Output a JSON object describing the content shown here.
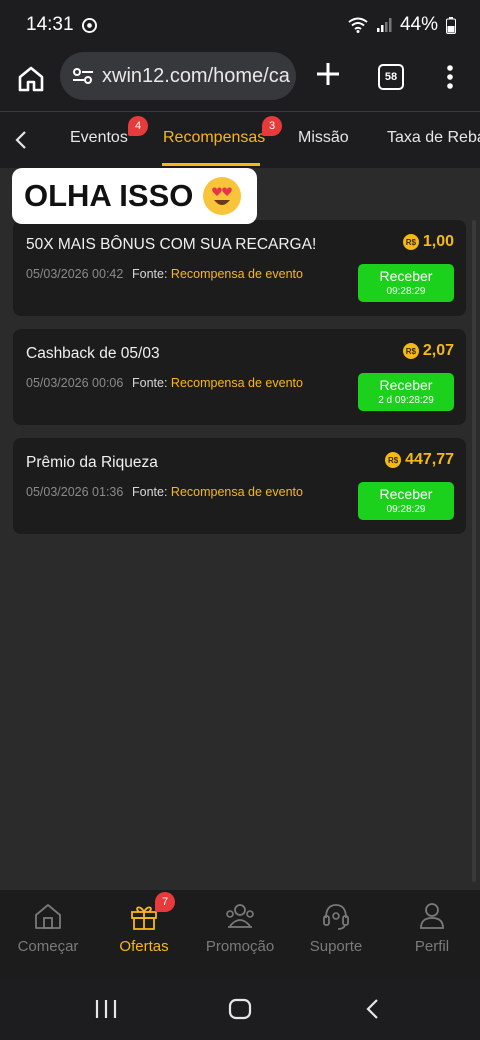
{
  "status_bar": {
    "time": "14:31",
    "battery": "44%"
  },
  "browser": {
    "url": "xwin12.com/home/ca",
    "tab_count": "58"
  },
  "category_tabs": [
    {
      "label": "Eventos",
      "badge": "4"
    },
    {
      "label": "Recompensas",
      "badge": "3",
      "active": true
    },
    {
      "label": "Missão"
    },
    {
      "label": "Taxa de Rebat"
    }
  ],
  "overlay": {
    "text": "OLHA ISSO"
  },
  "currency_symbol": "R$",
  "source_label": "Fonte:",
  "rewards": [
    {
      "title": "50X MAIS BÔNUS COM SUA RECARGA!",
      "amount": "1,00",
      "date": "05/03/2026 00:42",
      "source": "Recompensa de evento",
      "button": "Receber",
      "timer": "09:28:29"
    },
    {
      "title": "Cashback de 05/03",
      "amount": "2,07",
      "date": "05/03/2026 00:06",
      "source": "Recompensa de evento",
      "button": "Receber",
      "timer": "2 d 09:28:29"
    },
    {
      "title": "Prêmio da Riqueza",
      "amount": "447,77",
      "date": "05/03/2026 01:36",
      "source": "Recompensa de evento",
      "button": "Receber",
      "timer": "09:28:29"
    }
  ],
  "bottom_nav": [
    {
      "label": "Começar",
      "icon": "home-icon"
    },
    {
      "label": "Ofertas",
      "icon": "gift-icon",
      "badge": "7",
      "active": true
    },
    {
      "label": "Promoção",
      "icon": "people-icon"
    },
    {
      "label": "Suporte",
      "icon": "headset-icon"
    },
    {
      "label": "Perfil",
      "icon": "user-icon"
    }
  ],
  "colors": {
    "accent": "#f6b817",
    "button": "#1cd11c",
    "badge": "#e73a3a",
    "background": "#2b2b2b"
  }
}
